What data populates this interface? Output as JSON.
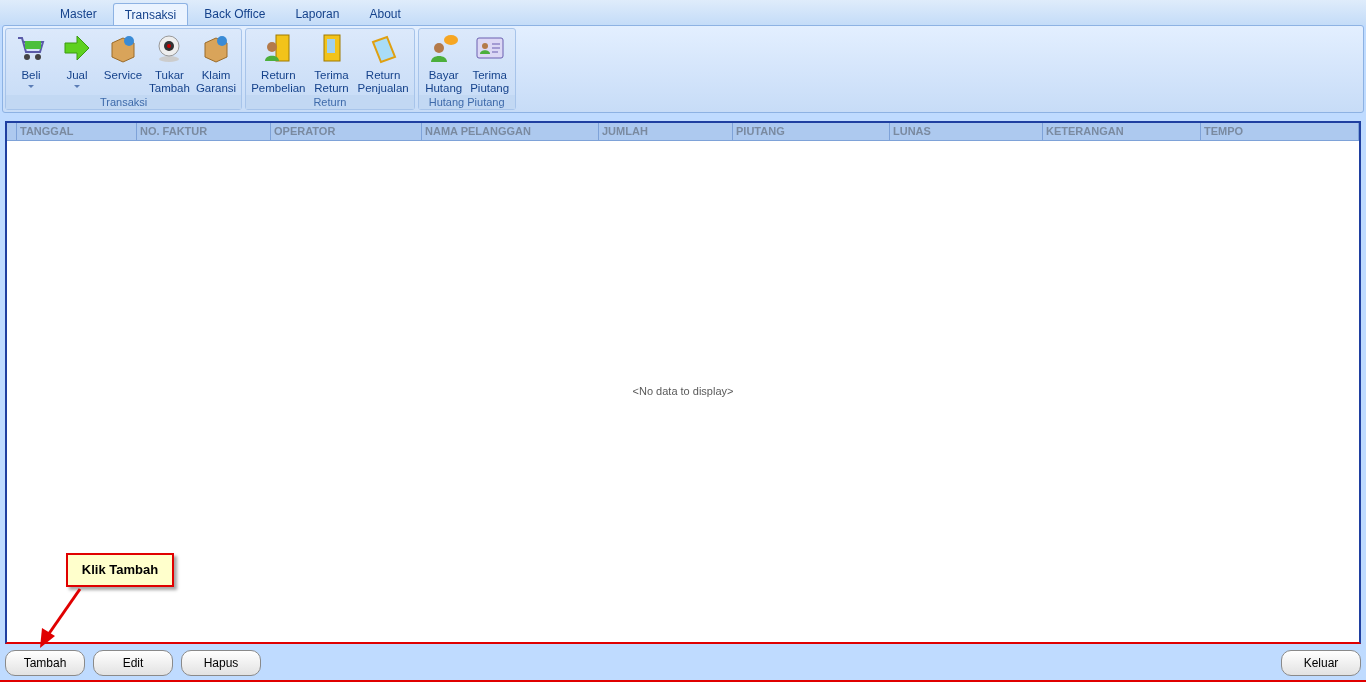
{
  "menu_tabs": [
    {
      "label": "Master",
      "selected": false
    },
    {
      "label": "Transaksi",
      "selected": true
    },
    {
      "label": "Back Office",
      "selected": false
    },
    {
      "label": "Laporan",
      "selected": false
    },
    {
      "label": "About",
      "selected": false
    }
  ],
  "ribbon_groups": [
    {
      "title": "Transaksi",
      "buttons": [
        {
          "label": "Beli",
          "dropdown": true
        },
        {
          "label": "Jual",
          "dropdown": true
        },
        {
          "label": "Service",
          "dropdown": false
        },
        {
          "label": "Tukar Tambah",
          "dropdown": false
        },
        {
          "label": "Klaim Garansi",
          "dropdown": false
        }
      ]
    },
    {
      "title": "Return",
      "buttons": [
        {
          "label": "Return Pembelian",
          "dropdown": false
        },
        {
          "label": "Terima Return",
          "dropdown": false
        },
        {
          "label": "Return Penjualan",
          "dropdown": false
        }
      ]
    },
    {
      "title": "Hutang Piutang",
      "buttons": [
        {
          "label": "Bayar Hutang",
          "dropdown": false
        },
        {
          "label": "Terima Piutang",
          "dropdown": false
        }
      ]
    }
  ],
  "table": {
    "columns": [
      "TANGGAL",
      "NO. FAKTUR",
      "OPERATOR",
      "NAMA PELANGGAN",
      "JUMLAH",
      "PIUTANG",
      "LUNAS",
      "KETERANGAN",
      "TEMPO"
    ],
    "empty_text": "<No data to display>"
  },
  "callout": {
    "text": "Klik Tambah"
  },
  "buttons_left": [
    "Tambah",
    "Edit",
    "Hapus"
  ],
  "buttons_right": [
    "Keluar"
  ]
}
